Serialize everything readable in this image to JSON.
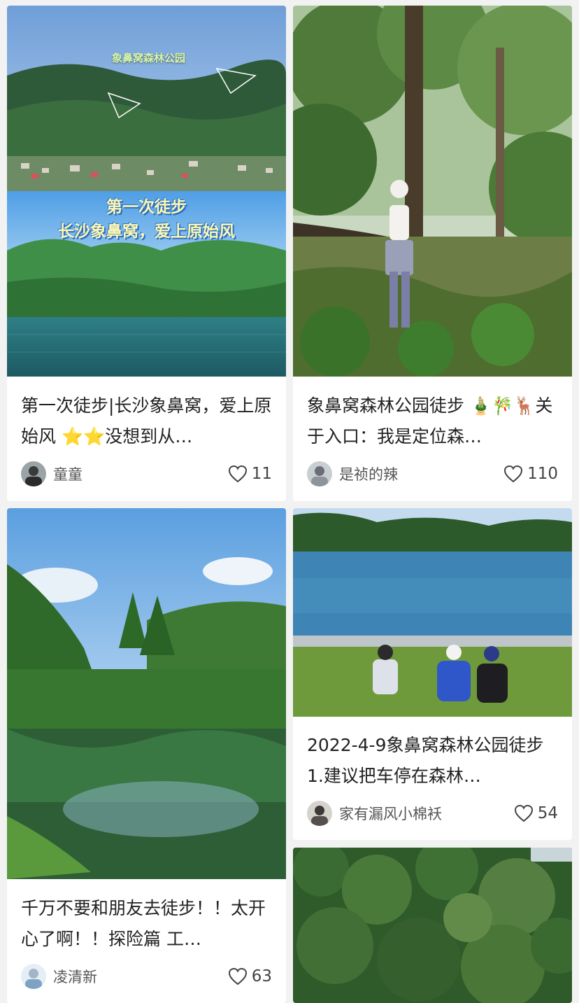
{
  "feed": {
    "cards": [
      {
        "title": "第一次徒步|长沙象鼻窝，爱上原始风 ⭐⭐没想到从…",
        "author": "童童",
        "likes": "11",
        "image_text": {
          "location": "象鼻窝森林公园",
          "line1": "第一次徒步",
          "line2": "长沙象鼻窝，爱上原始风"
        }
      },
      {
        "title": "象鼻窝森林公园徒步 🎍🎋🦌关于入口：我是定位森…",
        "author": "是祯的辣",
        "likes": "110"
      },
      {
        "title": "千万不要和朋友去徒步！！太开心了啊！！探险篇 工…",
        "author": "凌清新",
        "likes": "63"
      },
      {
        "title": "2022-4-9象鼻窝森林公园徒步 1.建议把车停在森林…",
        "author": "家有漏风小棉袄",
        "likes": "54"
      },
      {}
    ]
  },
  "colors": {
    "background": "#f2f2f2",
    "card": "#ffffff",
    "title_text": "#222222",
    "meta_text": "#555555"
  },
  "icons": [
    "heart-icon",
    "avatar",
    "paper-plane-icon"
  ]
}
